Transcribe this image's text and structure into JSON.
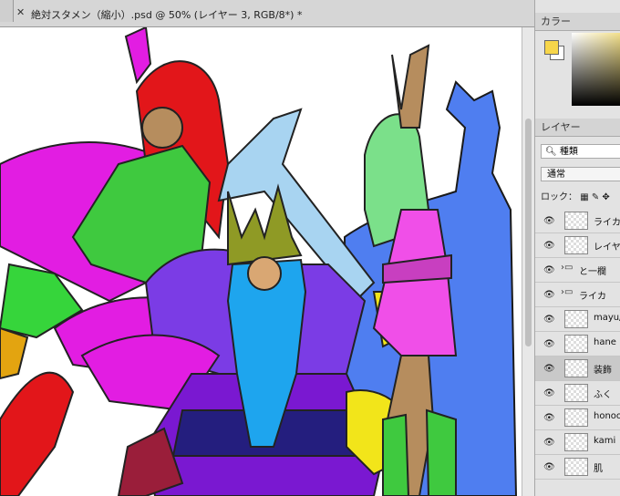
{
  "document": {
    "tab_title": "絶対スタメン（縮小）.psd @ 50% (レイヤー 3, RGB/8*) *",
    "close_icon": "close-icon"
  },
  "color_panel": {
    "tab_label": "カラー",
    "foreground": "#f7d64a",
    "background": "#ffffff"
  },
  "layers_panel": {
    "tab_label": "レイヤー",
    "search_placeholder": "種類",
    "blend_mode": "通常",
    "lock_label": "ロック：",
    "layers": [
      {
        "name": "ライカ",
        "type": "layer"
      },
      {
        "name": "レイヤー",
        "type": "layer"
      },
      {
        "name": "と一欄",
        "type": "group"
      },
      {
        "name": "ライカ",
        "type": "group"
      },
      {
        "name": "mayu/",
        "type": "layer"
      },
      {
        "name": "hane",
        "type": "layer"
      },
      {
        "name": "装飾",
        "type": "layer",
        "selected": true
      },
      {
        "name": "ふく",
        "type": "layer"
      },
      {
        "name": "honoo",
        "type": "layer"
      },
      {
        "name": "kami",
        "type": "layer"
      },
      {
        "name": "肌",
        "type": "layer"
      }
    ]
  }
}
